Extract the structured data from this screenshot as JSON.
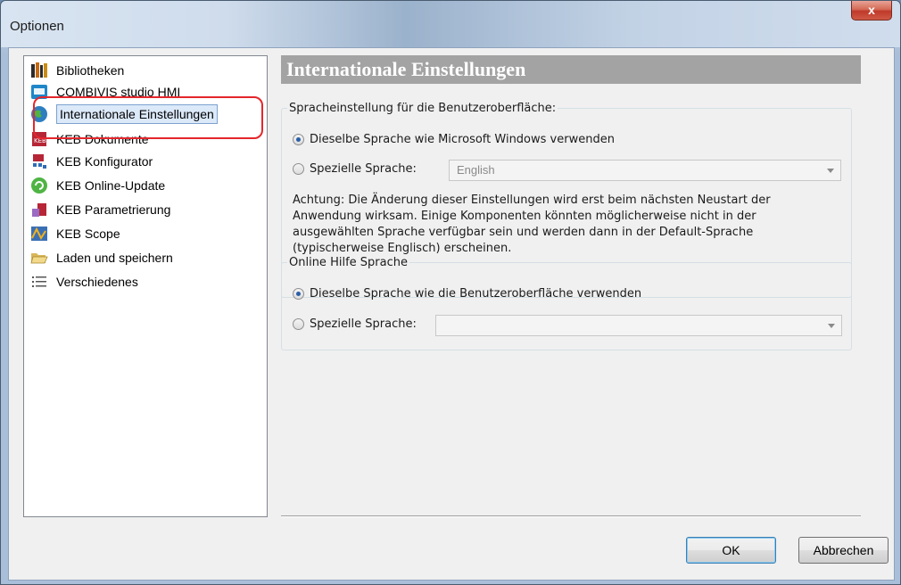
{
  "window": {
    "title": "Optionen",
    "close_label": "x"
  },
  "sidebar": {
    "items": [
      {
        "label": "Bibliotheken",
        "icon": "books-icon"
      },
      {
        "label": "COMBIVIS studio HMI",
        "icon": "hmi-icon"
      },
      {
        "label": "Internationale Einstellungen",
        "icon": "globe-icon",
        "selected": true
      },
      {
        "label": "KEB Dokumente",
        "icon": "keb-documents-icon"
      },
      {
        "label": "KEB Konfigurator",
        "icon": "keb-configurator-icon"
      },
      {
        "label": "KEB Online-Update",
        "icon": "online-update-icon"
      },
      {
        "label": "KEB Parametrierung",
        "icon": "parametrization-icon"
      },
      {
        "label": "KEB Scope",
        "icon": "scope-icon"
      },
      {
        "label": "Laden und speichern",
        "icon": "folder-open-icon"
      },
      {
        "label": "Verschiedenes",
        "icon": "list-icon"
      }
    ]
  },
  "panel": {
    "title": "Internationale Einstellungen",
    "ui_language": {
      "legend": "Spracheinstellung für die Benutzeroberfläche:",
      "option_same": "Dieselbe Sprache wie Microsoft Windows verwenden",
      "option_special": "Spezielle Sprache:",
      "selected_language": "English",
      "note": "Achtung: Die Änderung dieser Einstellungen wird erst beim nächsten Neustart der Anwendung wirksam. Einige Komponenten könnten möglicherweise nicht in der ausgewählten Sprache verfügbar sein und werden dann in der Default-Sprache (typischerweise Englisch) erscheinen."
    },
    "help_language": {
      "legend": "Online Hilfe Sprache",
      "option_same": "Dieselbe Sprache wie die Benutzeroberfläche verwenden",
      "option_special": "Spezielle Sprache:",
      "selected_language": ""
    }
  },
  "footer": {
    "ok_label": "OK",
    "cancel_label": "Abbrechen"
  },
  "colors": {
    "highlight": "#e4262c",
    "header_bg": "#a3a3a3",
    "selection_bg": "#dbe9f9"
  }
}
